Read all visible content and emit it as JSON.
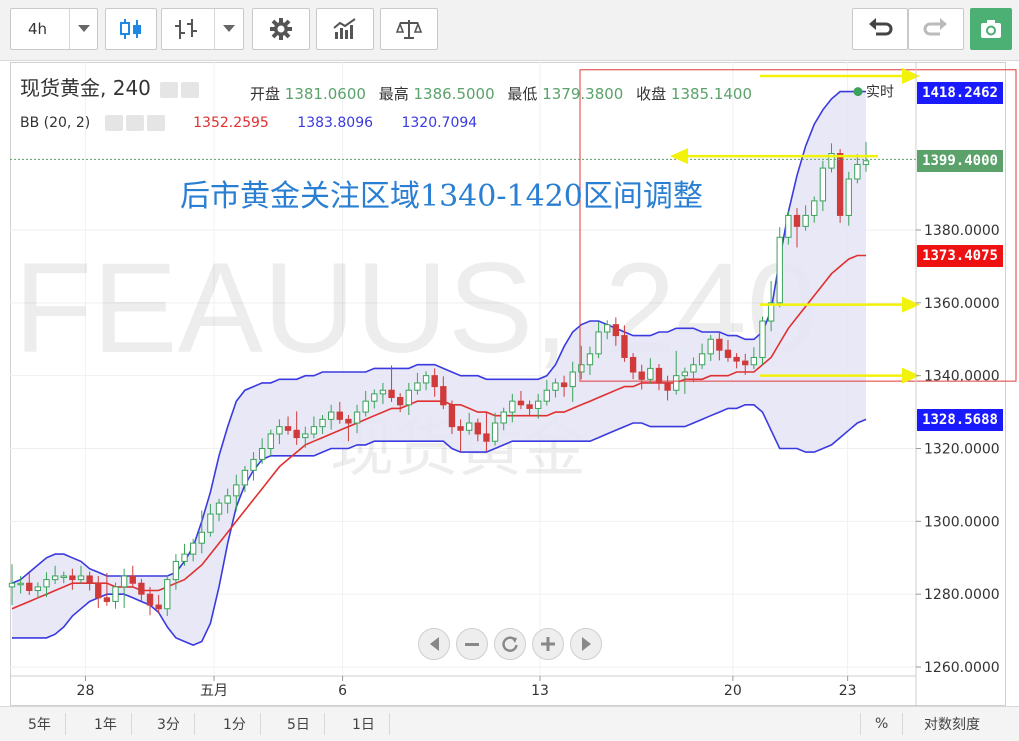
{
  "toolbar": {
    "interval": "4h",
    "dropdown_icon": "chevron-down-icon",
    "candle_icon": "candlestick-icon",
    "bar_icon": "bar-chart-icon",
    "settings_icon": "gear-icon",
    "indicator_icon": "indicators-icon",
    "compare_icon": "balance-scale-icon",
    "undo_icon": "undo-icon",
    "redo_icon": "redo-icon",
    "snapshot_icon": "camera-icon",
    "accent": "#4caf73"
  },
  "legend": {
    "symbol": "现货黄金, 240",
    "open_label": "开盘",
    "open": "1381.0600",
    "high_label": "最高",
    "high": "1386.5000",
    "low_label": "最低",
    "low": "1379.3800",
    "close_label": "收盘",
    "close": "1385.1400",
    "bb_label": "BB (20, 2)",
    "bb_mid": "1352.2595",
    "bb_upper": "1383.8096",
    "bb_lower": "1320.7094"
  },
  "watermark": {
    "text": "FEAUUS, 240",
    "subtext": "现货黄金"
  },
  "annotation": {
    "text": "后市黄金关注区域1340-1420区间调整",
    "realtime_label": "实时"
  },
  "price_tags": [
    {
      "value": "1418.2462",
      "color": "#1a1aff"
    },
    {
      "value": "1399.4000",
      "color": "#5aa26a"
    },
    {
      "value": "1373.4075",
      "color": "#ee1111"
    },
    {
      "value": "1328.5688",
      "color": "#1a1aff"
    }
  ],
  "nav_buttons": {
    "left": "chevron-left-icon",
    "zoom_out": "minus-icon",
    "reset": "reset-icon",
    "zoom_in": "plus-icon",
    "right": "chevron-right-icon"
  },
  "bottom_bar": {
    "ranges": [
      "5年",
      "1年",
      "3分",
      "1分",
      "5日",
      "1日"
    ],
    "percent": "%",
    "log_scale": "对数刻度"
  },
  "chart_data": {
    "type": "candlestick",
    "title": "现货黄金, 240",
    "x_ticks": [
      "28",
      "五月",
      "6",
      "13",
      "20",
      "23"
    ],
    "y_ticks": [
      "1260.0000",
      "1280.0000",
      "1300.0000",
      "1320.0000",
      "1340.0000",
      "1360.0000",
      "1380.0000"
    ],
    "ylim": [
      1257,
      1424
    ],
    "last_price": 1399.4,
    "colors": {
      "up": "#3aa35a",
      "down": "#d03a3a",
      "bb_upper_lower": "#3a3ae0",
      "bb_mid": "#e03030",
      "bb_fill": "#e4e4f4",
      "annot_box": "#e03a3a",
      "arrows": "#f2f20a"
    },
    "highlight_box": {
      "price_top": 1424,
      "price_bottom": 1338.5
    },
    "arrows": [
      {
        "price": 1422.3,
        "direction": "right"
      },
      {
        "price": 1400.3,
        "direction": "left"
      },
      {
        "price": 1359.5,
        "direction": "right"
      },
      {
        "price": 1340.0,
        "direction": "right"
      }
    ],
    "closes": [
      1283,
      1283,
      1281,
      1282,
      1284,
      1285,
      1285,
      1284,
      1285,
      1283,
      1279,
      1278,
      1282,
      1285,
      1283,
      1280,
      1277,
      1276,
      1284,
      1289,
      1291,
      1294,
      1297,
      1302,
      1305,
      1307,
      1310,
      1314,
      1317,
      1320,
      1324,
      1326,
      1325,
      1323,
      1324,
      1326,
      1328,
      1330,
      1328,
      1327,
      1330,
      1333,
      1335,
      1336,
      1334,
      1332,
      1336,
      1338,
      1340,
      1337,
      1332,
      1326,
      1325,
      1327,
      1324,
      1322,
      1327,
      1330,
      1333,
      1332,
      1331,
      1333,
      1336,
      1338,
      1337,
      1341,
      1343,
      1346,
      1352,
      1354,
      1351,
      1345,
      1341,
      1339,
      1342,
      1338,
      1336,
      1340,
      1341,
      1343,
      1346,
      1350,
      1347,
      1345,
      1344,
      1343,
      1345,
      1355,
      1360,
      1378,
      1384,
      1381,
      1384,
      1388,
      1397,
      1401,
      1384,
      1394,
      1398,
      1399
    ],
    "bb_mid": [
      1276,
      1277,
      1278,
      1279,
      1280,
      1281,
      1282,
      1283,
      1283,
      1283,
      1283,
      1283,
      1282,
      1282,
      1282,
      1281,
      1281,
      1281,
      1282,
      1283,
      1284,
      1286,
      1288,
      1291,
      1294,
      1297,
      1300,
      1303,
      1306,
      1309,
      1312,
      1315,
      1317,
      1319,
      1321,
      1322,
      1323,
      1324,
      1325,
      1326,
      1327,
      1328,
      1329,
      1330,
      1331,
      1331,
      1332,
      1333,
      1333,
      1333,
      1333,
      1332,
      1332,
      1331,
      1330,
      1330,
      1329,
      1329,
      1329,
      1329,
      1329,
      1329,
      1329,
      1330,
      1330,
      1331,
      1332,
      1333,
      1334,
      1335,
      1336,
      1337,
      1337,
      1338,
      1338,
      1338,
      1338,
      1338,
      1339,
      1339,
      1339,
      1340,
      1340,
      1340,
      1341,
      1341,
      1341,
      1343,
      1345,
      1349,
      1353,
      1356,
      1359,
      1362,
      1365,
      1368,
      1370,
      1372,
      1373,
      1373
    ],
    "bb_upper": [
      1283,
      1284,
      1286,
      1288,
      1290,
      1291,
      1291,
      1290,
      1289,
      1287,
      1286,
      1285,
      1285,
      1285,
      1285,
      1285,
      1285,
      1285,
      1285,
      1286,
      1289,
      1293,
      1300,
      1308,
      1318,
      1326,
      1333,
      1336,
      1337,
      1338,
      1338,
      1339,
      1339,
      1339,
      1340,
      1340,
      1341,
      1341,
      1341,
      1341,
      1341,
      1341,
      1342,
      1342,
      1342,
      1342,
      1342,
      1343,
      1343,
      1343,
      1342,
      1341,
      1340,
      1340,
      1340,
      1339,
      1339,
      1339,
      1339,
      1339,
      1339,
      1339,
      1340,
      1343,
      1348,
      1352,
      1354,
      1355,
      1355,
      1354,
      1353,
      1352,
      1351,
      1351,
      1351,
      1352,
      1352,
      1353,
      1353,
      1353,
      1352,
      1352,
      1352,
      1351,
      1351,
      1350,
      1350,
      1352,
      1358,
      1372,
      1385,
      1395,
      1403,
      1409,
      1413,
      1416,
      1418,
      1418,
      1418,
      1418
    ],
    "bb_lower": [
      1268,
      1268,
      1268,
      1268,
      1268,
      1269,
      1271,
      1274,
      1276,
      1278,
      1279,
      1280,
      1280,
      1280,
      1279,
      1278,
      1277,
      1275,
      1271,
      1268,
      1267,
      1266,
      1267,
      1272,
      1282,
      1294,
      1304,
      1310,
      1314,
      1317,
      1318,
      1318,
      1318,
      1318,
      1318,
      1318,
      1319,
      1320,
      1320,
      1320,
      1321,
      1321,
      1322,
      1322,
      1322,
      1322,
      1322,
      1322,
      1322,
      1322,
      1322,
      1320,
      1319,
      1319,
      1319,
      1319,
      1320,
      1321,
      1322,
      1322,
      1322,
      1322,
      1322,
      1322,
      1322,
      1322,
      1322,
      1322,
      1323,
      1324,
      1325,
      1326,
      1327,
      1327,
      1326,
      1326,
      1326,
      1326,
      1326,
      1327,
      1328,
      1329,
      1330,
      1331,
      1331,
      1332,
      1332,
      1330,
      1325,
      1320,
      1320,
      1320,
      1319,
      1319,
      1320,
      1321,
      1323,
      1325,
      1327,
      1328
    ]
  }
}
